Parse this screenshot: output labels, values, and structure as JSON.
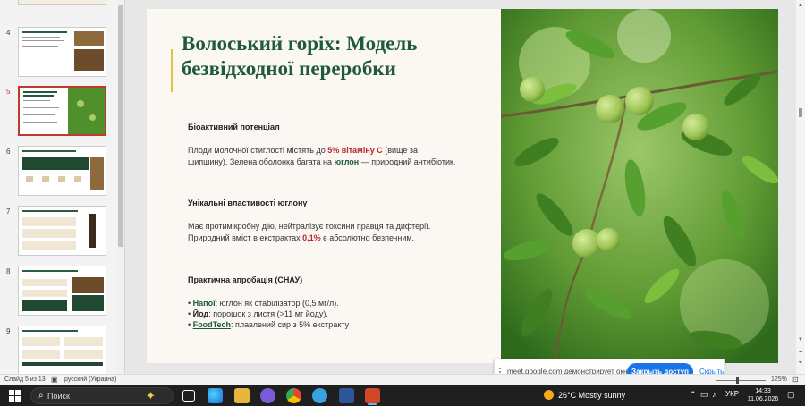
{
  "thumbnails": [
    {
      "num": "4",
      "active": false
    },
    {
      "num": "5",
      "active": true
    },
    {
      "num": "6",
      "active": false
    },
    {
      "num": "7",
      "active": false
    },
    {
      "num": "8",
      "active": false
    },
    {
      "num": "9",
      "active": false
    }
  ],
  "slide": {
    "title": "Волоський горіх: Модель безвідходної переробки",
    "sections": [
      {
        "heading": "Біоактивний потенціал",
        "p1": "Плоди молочної стиглості містять до ",
        "p1_hl": "5% вітаміну С",
        "p1b": " (вище за шипшину). Зелена оболонка багата на ",
        "p1_hl2": "юглон",
        "p1c": " — природний антибіотик."
      },
      {
        "heading": "Унікальні властивості юглону",
        "p1": "Має протимікробну дію, нейтралізує токсини правця та дифтерії. Природний вміст в екстрактах ",
        "p1_hl": "0,1%",
        "p1b": " є абсолютно безпечним."
      },
      {
        "heading": "Практична апробація (СНАУ)",
        "bullets": [
          {
            "key": "Напої",
            "text": ": юглон як стабілізатор (0,5 мг/л)."
          },
          {
            "key": "Йод",
            "text": ": порошок з листя (>11 мг йоду)."
          },
          {
            "key": "FoodTech",
            "text": ": плавлений сир з 5% екстракту"
          }
        ]
      }
    ]
  },
  "meet": {
    "text": "meet.google.com демонстрирует окно.",
    "share_btn": "Закрыть доступ",
    "hide_link": "Скрыть"
  },
  "status": {
    "slide_info": "Слайд 5 из 13",
    "language": "русский (Украина)",
    "zoom": "125%"
  },
  "taskbar": {
    "search_label": "Поиск",
    "weather": "26°C  Mostly sunny",
    "lang": "УКР",
    "time": "14:33",
    "date": "11.06.2026"
  },
  "colors": {
    "title_green": "#1f5a3b",
    "accent_red": "#b8262b",
    "accent_gold": "#e2c044",
    "meet_blue": "#1a73e8"
  }
}
